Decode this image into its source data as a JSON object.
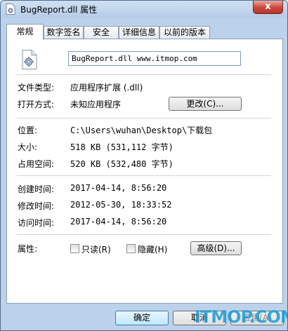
{
  "window": {
    "title": "BugReport.dll 属性",
    "close_glyph": "x"
  },
  "tabs": [
    {
      "label": "常规",
      "active": true
    },
    {
      "label": "数字签名"
    },
    {
      "label": "安全"
    },
    {
      "label": "详细信息"
    },
    {
      "label": "以前的版本"
    }
  ],
  "general": {
    "file_name": "BugReport.dll www.itmop.com",
    "file_type_label": "文件类型:",
    "file_type_value": "应用程序扩展 (.dll)",
    "open_with_label": "打开方式:",
    "open_with_value": "未知应用程序",
    "change_button": "更改(C)...",
    "location_label": "位置:",
    "location_value": "C:\\Users\\wuhan\\Desktop\\下载包",
    "size_label": "大小:",
    "size_value": "518 KB (531,112 字节)",
    "size_on_disk_label": "占用空间:",
    "size_on_disk_value": "520 KB (532,480 字节)",
    "created_label": "创建时间:",
    "created_value": "2017-04-14, 8:56:20",
    "modified_label": "修改时间:",
    "modified_value": "2012-05-30, 18:33:52",
    "accessed_label": "访问时间:",
    "accessed_value": "2017-04-14, 8:56:20",
    "attributes_label": "属性:",
    "readonly_label": "只读(R)",
    "hidden_label": "隐藏(H)",
    "advanced_button": "高级(D)..."
  },
  "footer": {
    "ok": "确定",
    "cancel": "取消",
    "apply": "应用(A)"
  },
  "watermark": "ITMOP.COM"
}
